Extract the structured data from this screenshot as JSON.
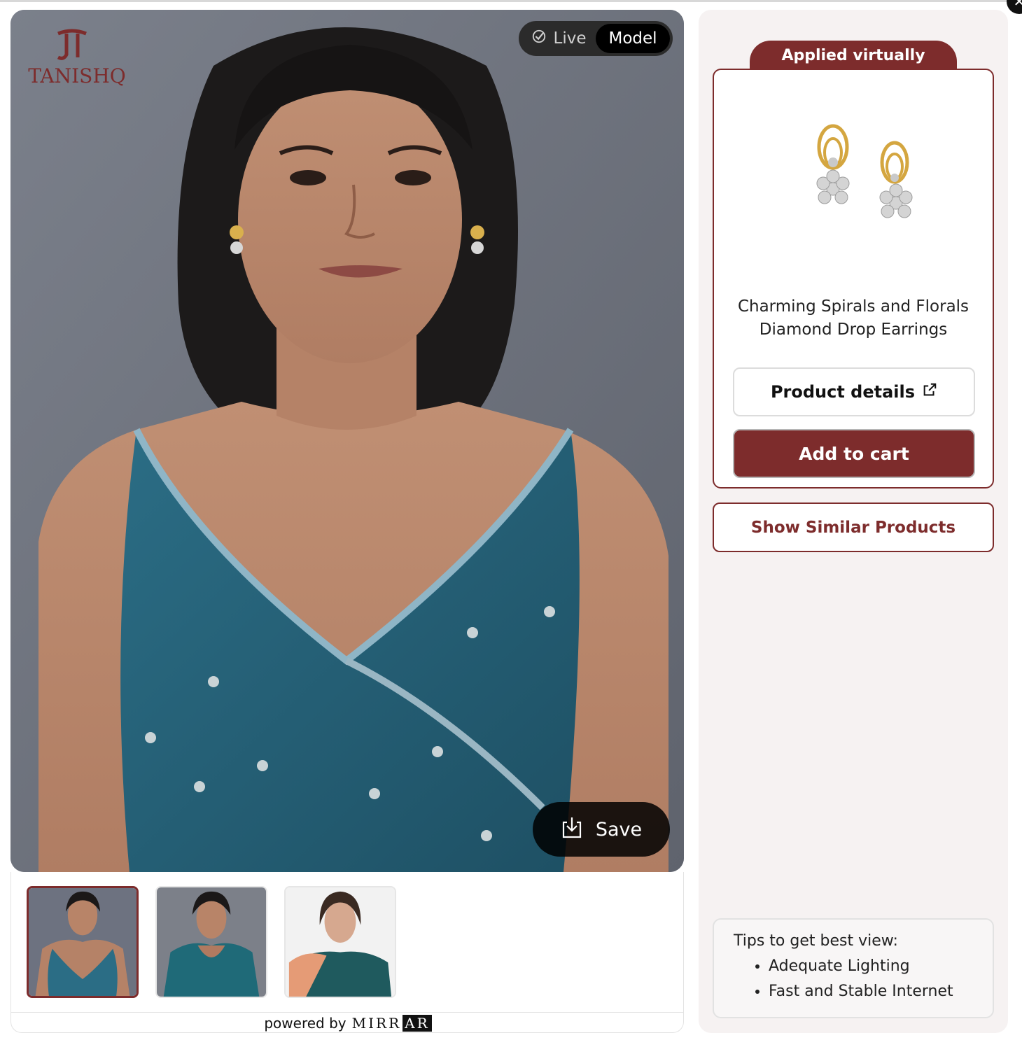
{
  "brand": {
    "logo_text": "TANISHQ",
    "color": "#7d2c2c"
  },
  "viewer": {
    "mode_toggle": {
      "live_label": "Live",
      "model_label": "Model",
      "selected": "Model"
    },
    "save_label": "Save"
  },
  "thumbnails": [
    {
      "name": "model-1",
      "selected": true
    },
    {
      "name": "model-2",
      "selected": false
    },
    {
      "name": "model-3",
      "selected": false
    }
  ],
  "footer": {
    "powered_by": "powered by",
    "brand_main": "MIRR",
    "brand_box": "AR"
  },
  "product_card": {
    "badge": "Applied virtually",
    "name_line1": "Charming Spirals and Florals",
    "name_line2": "Diamond Drop Earrings",
    "details_label": "Product details",
    "cart_label": "Add to cart"
  },
  "similar_label": "Show Similar Products",
  "tips": {
    "heading": "Tips to get best view:",
    "items": [
      "Adequate Lighting",
      "Fast and Stable Internet"
    ]
  },
  "icons": [
    "close-icon",
    "check-circle-icon",
    "download-icon",
    "external-link-icon",
    "tanishq-logo"
  ]
}
